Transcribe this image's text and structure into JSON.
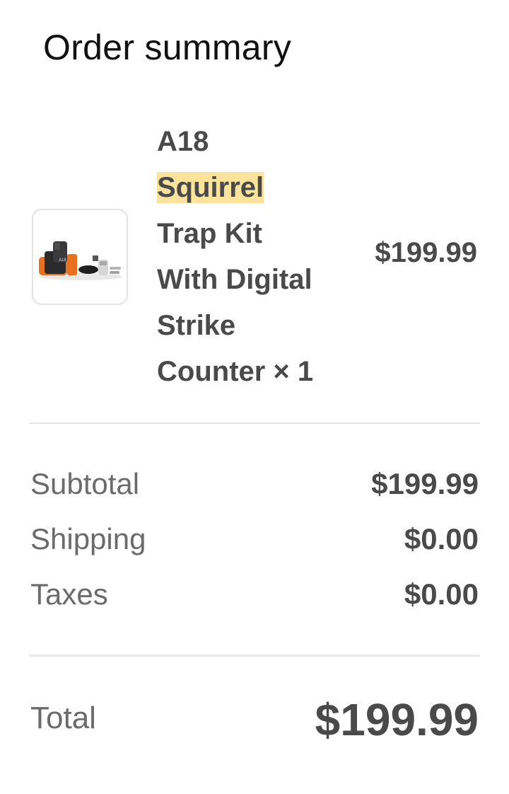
{
  "header": {
    "title": "Order summary"
  },
  "item": {
    "name_lines": [
      "A18",
      "Squirrel",
      "Trap Kit",
      "With Digital",
      "Strike",
      "Counter × 1"
    ],
    "highlighted_term": "Squirrel",
    "price": "$199.99",
    "image_icon": "product-trap-kit-image",
    "highlight_color": "#fbe39c"
  },
  "summary": {
    "rows": [
      {
        "label": "Subtotal",
        "value": "$199.99"
      },
      {
        "label": "Shipping",
        "value": "$0.00"
      },
      {
        "label": "Taxes",
        "value": "$0.00"
      }
    ],
    "total_label": "Total",
    "total_value": "$199.99"
  }
}
